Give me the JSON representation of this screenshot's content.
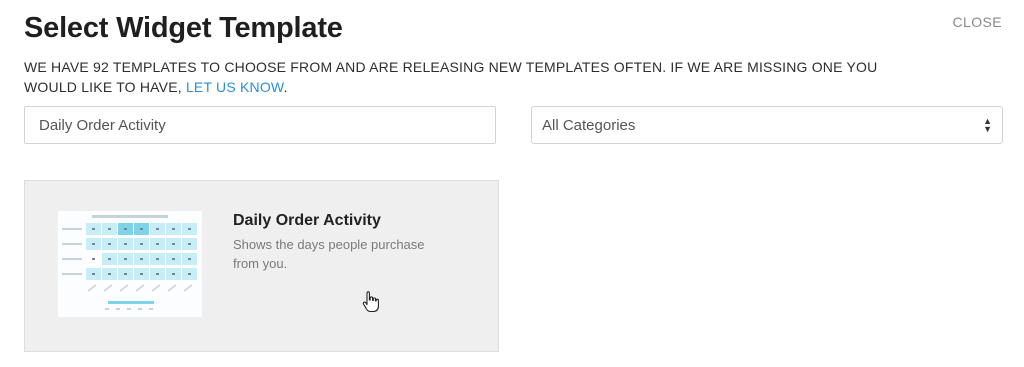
{
  "header": {
    "title": "Select Widget Template",
    "close_label": "CLOSE"
  },
  "description": {
    "text": "WE HAVE 92 TEMPLATES TO CHOOSE FROM AND ARE RELEASING NEW TEMPLATES OFTEN. IF WE ARE MISSING ONE YOU WOULD LIKE TO HAVE, ",
    "link": "LET US KNOW",
    "suffix": "."
  },
  "search": {
    "value": "Daily Order Activity"
  },
  "category_select": {
    "selected": "All Categories"
  },
  "templates": [
    {
      "title": "Daily Order Activity",
      "description": "Shows the days people purchase from you."
    }
  ],
  "colors": {
    "link": "#2e8fd6",
    "heat_dark": "#7fd3e8",
    "heat_light": "#c9edf6"
  }
}
